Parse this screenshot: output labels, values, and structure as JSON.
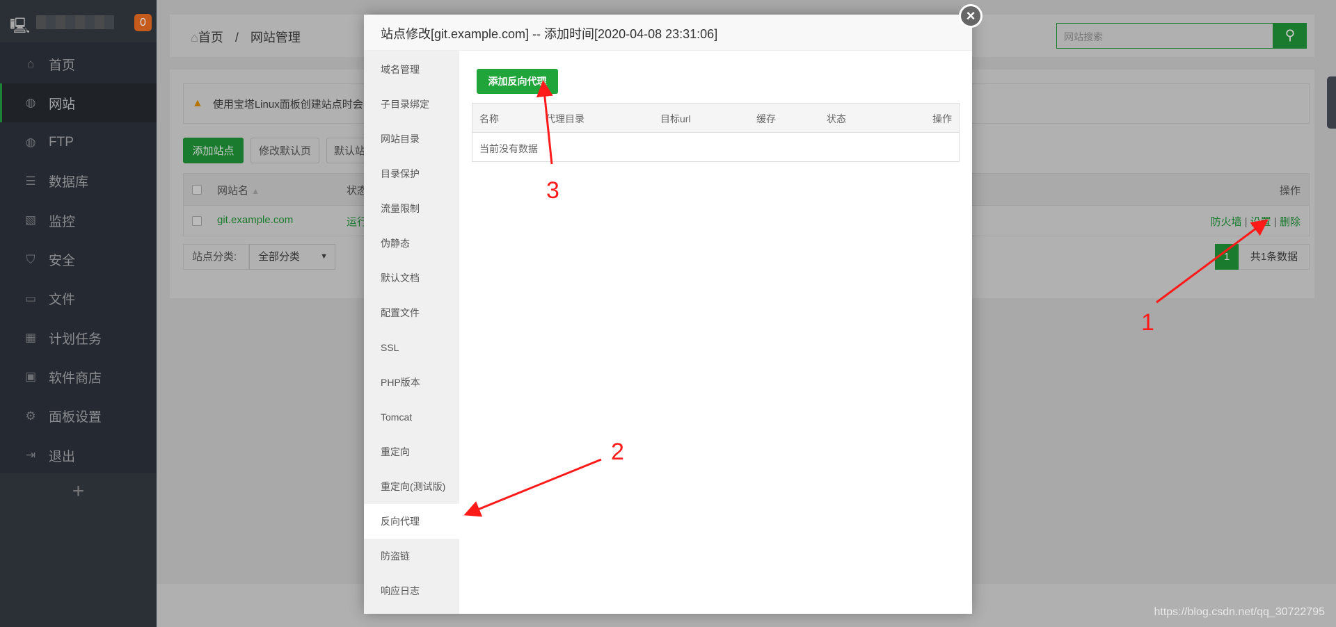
{
  "sidebar": {
    "badge": "0",
    "items": [
      {
        "label": "首页",
        "icon": "home-icon",
        "glyph": "⌂"
      },
      {
        "label": "网站",
        "icon": "globe-icon",
        "glyph": "◍",
        "active": true
      },
      {
        "label": "FTP",
        "icon": "ftp-icon",
        "glyph": "◍"
      },
      {
        "label": "数据库",
        "icon": "database-icon",
        "glyph": "☰"
      },
      {
        "label": "监控",
        "icon": "monitor-icon",
        "glyph": "▧"
      },
      {
        "label": "安全",
        "icon": "shield-icon",
        "glyph": "⛉"
      },
      {
        "label": "文件",
        "icon": "folder-icon",
        "glyph": "▭"
      },
      {
        "label": "计划任务",
        "icon": "calendar-icon",
        "glyph": "▦"
      },
      {
        "label": "软件商店",
        "icon": "apps-icon",
        "glyph": "▣"
      },
      {
        "label": "面板设置",
        "icon": "gear-icon",
        "glyph": "⚙"
      },
      {
        "label": "退出",
        "icon": "logout-icon",
        "glyph": "⇥"
      }
    ],
    "add": "+"
  },
  "breadcrumb": {
    "home": "首页",
    "sep": "/",
    "current": "网站管理"
  },
  "search": {
    "placeholder": "网站搜索"
  },
  "content": {
    "alert": "使用宝塔Linux面板创建站点时会",
    "buttons": {
      "add_site": "添加站点",
      "edit_default": "修改默认页",
      "default_site": "默认站"
    },
    "table": {
      "headers": {
        "name": "网站名",
        "status": "状态",
        "actions": "操作"
      },
      "rows": [
        {
          "name": "git.example.com",
          "status": "运行",
          "actions": [
            "防火墙",
            "设置",
            "删除"
          ]
        }
      ]
    },
    "category_label": "站点分类:",
    "category_value": "全部分类",
    "page": "1",
    "total": "共1条数据"
  },
  "modal": {
    "title": "站点修改[git.example.com] -- 添加时间[2020-04-08 23:31:06]",
    "menu": [
      "域名管理",
      "子目录绑定",
      "网站目录",
      "目录保护",
      "流量限制",
      "伪静态",
      "默认文档",
      "配置文件",
      "SSL",
      "PHP版本",
      "Tomcat",
      "重定向",
      "重定向(测试版)",
      "反向代理",
      "防盗链",
      "响应日志"
    ],
    "active_menu": "反向代理",
    "add_button": "添加反向代理",
    "table_headers": [
      "名称",
      "代理目录",
      "目标url",
      "缓存",
      "状态",
      "操作"
    ],
    "empty": "当前没有数据"
  },
  "annotations": [
    "1",
    "2",
    "3"
  ],
  "watermark": "https://blog.csdn.net/qq_30722795",
  "colors": {
    "accent": "#20a53a",
    "annotation": "#ff1a1a"
  }
}
